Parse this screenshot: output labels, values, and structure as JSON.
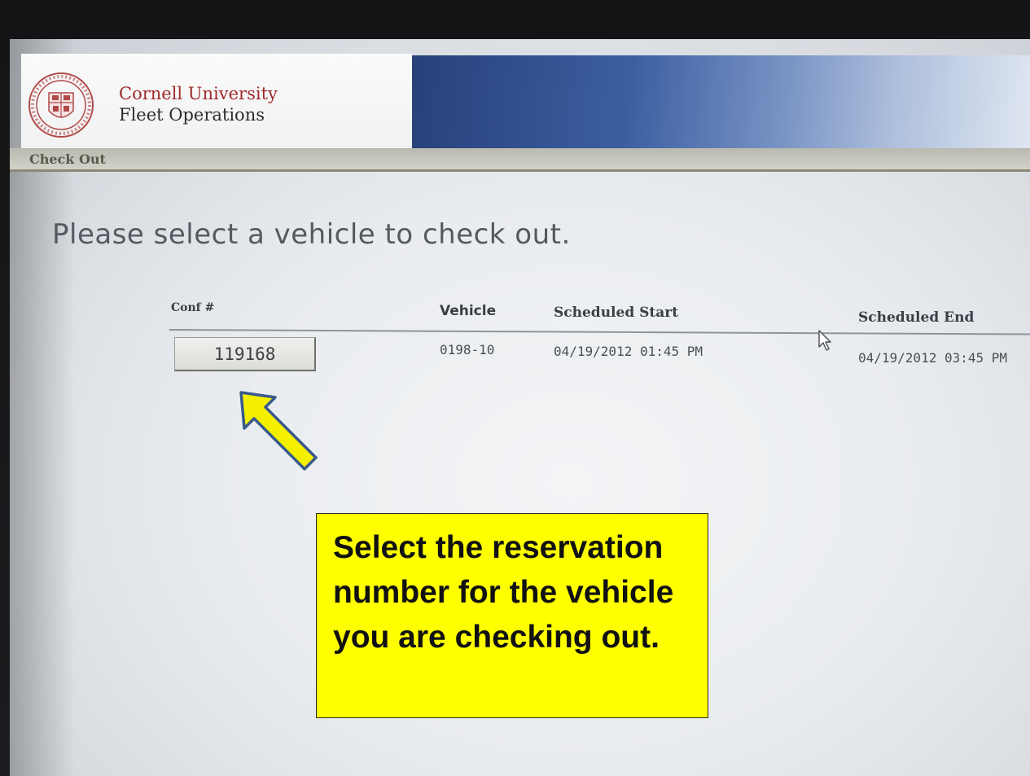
{
  "header": {
    "brand_line1": "Cornell University",
    "brand_line2": "Fleet Operations",
    "logo_icon": "cornell-seal-icon"
  },
  "nav": {
    "tab_label": "Check Out"
  },
  "main": {
    "title": "Please select a vehicle to check out.",
    "table": {
      "columns": [
        "Conf #",
        "Vehicle",
        "Scheduled Start",
        "Scheduled End"
      ],
      "rows": [
        {
          "conf": "119168",
          "vehicle": "0198-10",
          "scheduled_start": "04/19/2012 01:45 PM",
          "scheduled_end": "04/19/2012 03:45 PM"
        }
      ]
    }
  },
  "annotation": {
    "callout_text": "Select the reservation number for the vehicle you are checking out.",
    "arrow_icon": "pointer-arrow-icon",
    "highlight_color": "#ffff00",
    "arrow_color": "#f5f000",
    "arrow_outline_color": "#3a5a8c"
  },
  "colors": {
    "brand_red": "#9e2a2b",
    "banner_blue": "#27417a"
  }
}
